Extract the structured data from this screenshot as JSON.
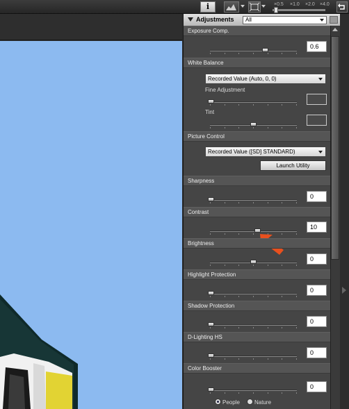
{
  "toolbar": {
    "info_glyph": "i",
    "zoom_labels": [
      "×0.5",
      "×1.0",
      "×2.0",
      "×4.0"
    ],
    "icons": [
      "info-icon",
      "histogram-icon",
      "fit-screen-icon",
      "rotate-icon"
    ]
  },
  "panel": {
    "title": "Adjustments",
    "filter_value": "All"
  },
  "sections": {
    "exposure": {
      "label": "Exposure Comp.",
      "value": "0.6",
      "level": 0.6
    },
    "white_balance": {
      "label": "White Balance",
      "preset": "Recorded Value (Auto, 0, 0)",
      "fine_label": "Fine Adjustment",
      "tint_label": "Tint"
    },
    "picture_control": {
      "label": "Picture Control",
      "preset": "Recorded Value ([SD] STANDARD)",
      "launch_label": "Launch Utility"
    },
    "sharpness": {
      "label": "Sharpness",
      "value": "0"
    },
    "contrast": {
      "label": "Contrast",
      "value": "10"
    },
    "brightness": {
      "label": "Brightness",
      "value": "0"
    },
    "highlight": {
      "label": "Highlight Protection",
      "value": "0"
    },
    "shadow": {
      "label": "Shadow Protection",
      "value": "0"
    },
    "dlighting": {
      "label": "D-Lighting HS",
      "value": "0"
    },
    "color_booster": {
      "label": "Color Booster",
      "value": "0",
      "options": [
        "People",
        "Nature"
      ],
      "selected": "People"
    }
  },
  "colors": {
    "sky": "#8cbaf0",
    "panel": "#454545",
    "annotation_arrow": "#e8501e"
  }
}
